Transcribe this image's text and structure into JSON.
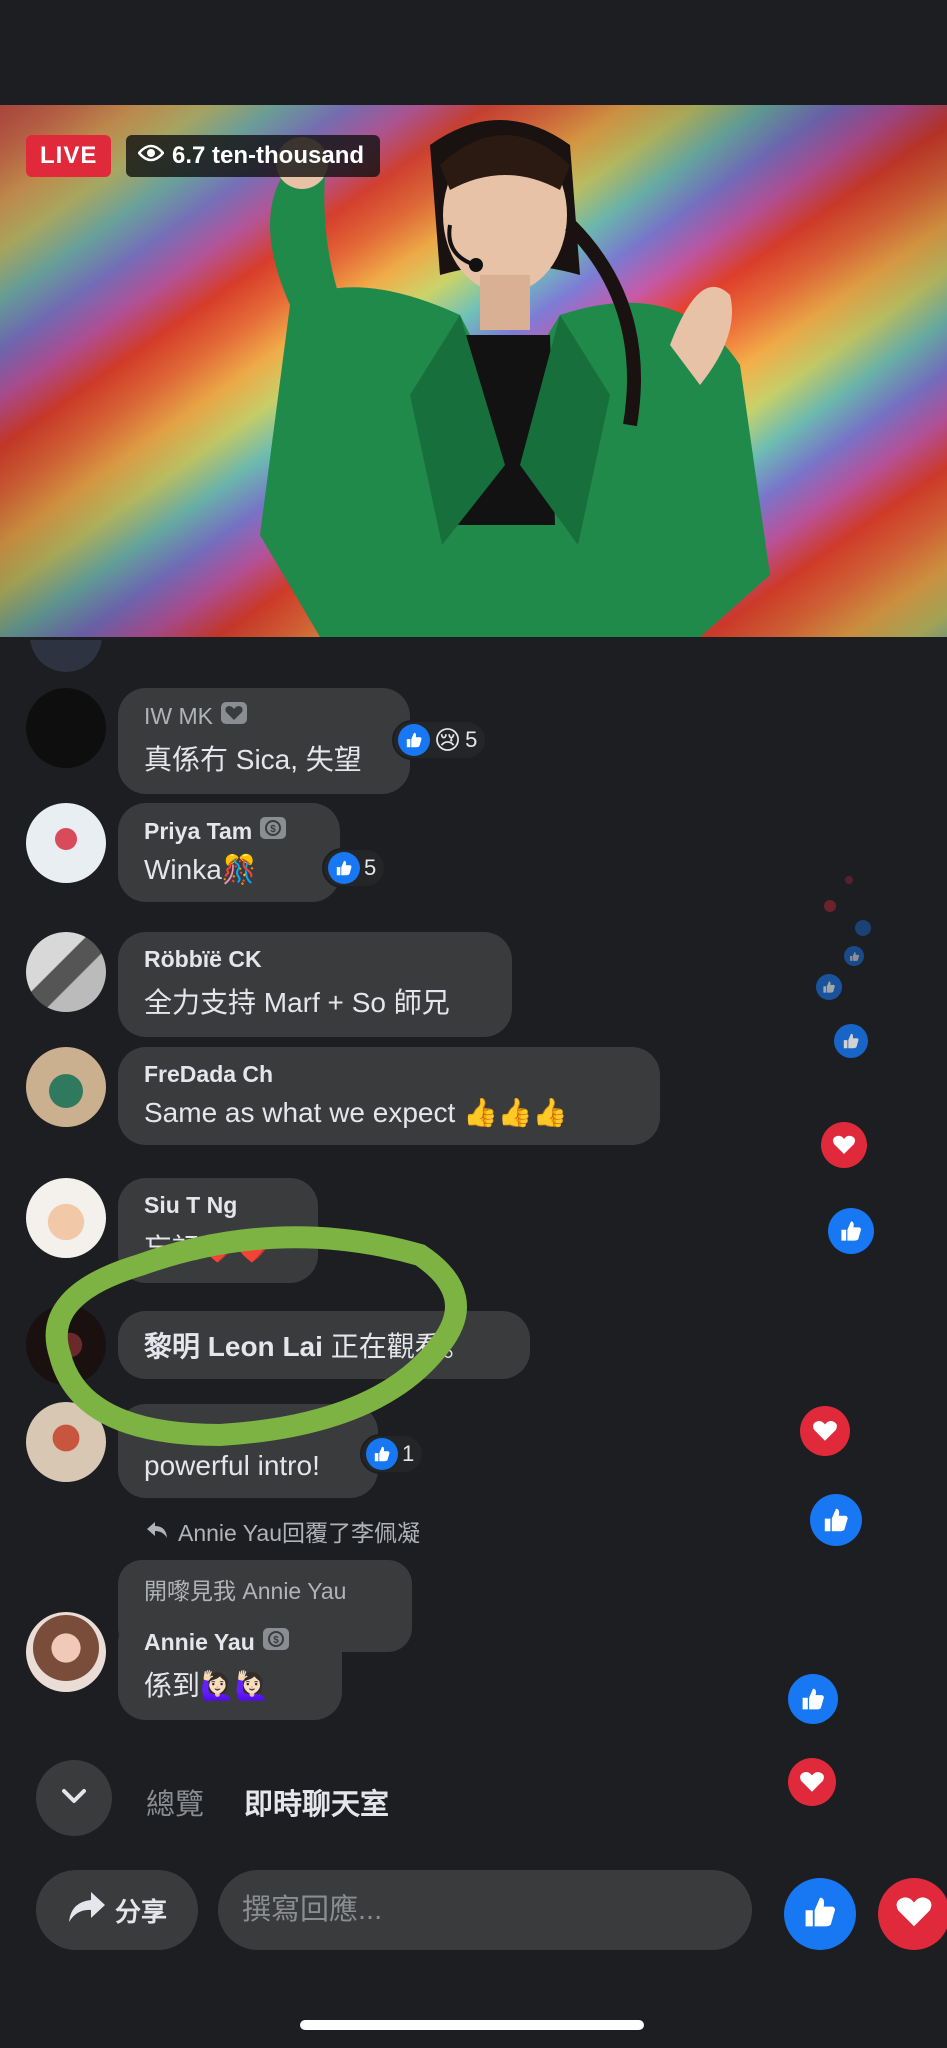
{
  "video": {
    "live_label": "LIVE",
    "viewer_count": "6.7 ten-thousand"
  },
  "comments": [
    {
      "name": "IW MK",
      "text": "真係冇 Sica, 失望",
      "reaction_count": "5"
    },
    {
      "name": "Priya Tam",
      "text": "Winka🎊",
      "reaction_count": "5"
    },
    {
      "name": "Röbbïë CK",
      "text": "全力支持 Marf + So 師兄"
    },
    {
      "name": "FreDada Ch",
      "text": "Same as what we expect 👍👍👍"
    },
    {
      "name": "Siu T Ng",
      "text": "忘記❤️❤️"
    },
    {
      "name": "黎明 Leon Lai",
      "text": "正在觀看。"
    },
    {
      "text": "powerful intro!",
      "reaction_count": "1"
    }
  ],
  "reply": {
    "context": "Annie Yau回覆了李佩凝",
    "quoted": "開嚟見我 Annie Yau",
    "name": "Annie Yau",
    "text": "係到🙋🏻‍♀️🙋🏻‍♀️"
  },
  "tabs": {
    "overview": "總覽",
    "chat": "即時聊天室"
  },
  "footer": {
    "share_label": "分享",
    "comment_placeholder": "撰寫回應..."
  },
  "colors": {
    "background": "#1c1e21",
    "bubble": "#3a3b3d",
    "like_blue": "#1877f2",
    "love_red": "#e02a3b",
    "annotation_green": "#7cb342"
  }
}
